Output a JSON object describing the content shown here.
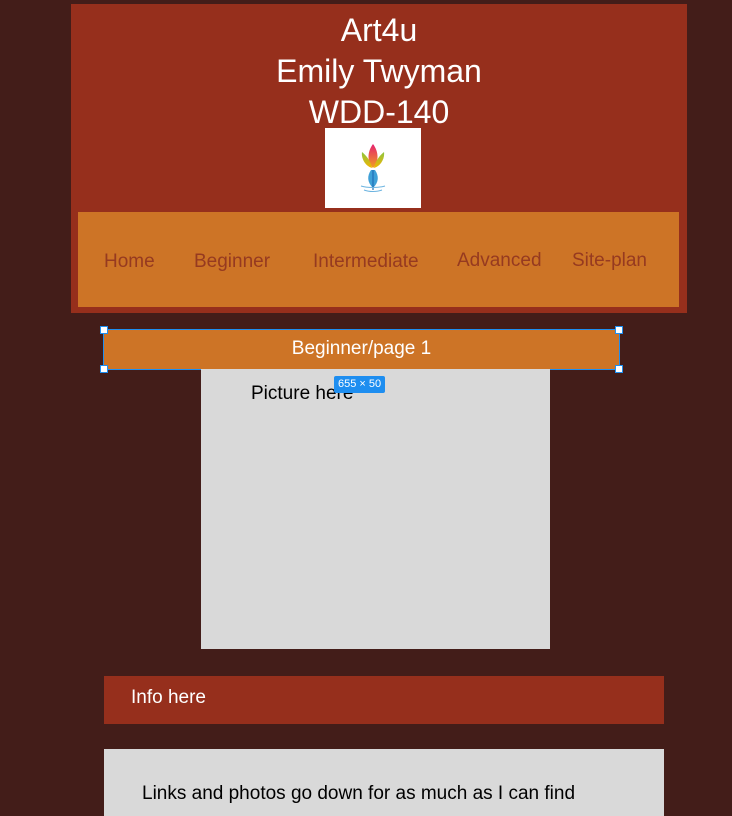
{
  "header": {
    "title_line_1": "Art4u",
    "title_line_2": "Emily Twyman",
    "title_line_3": "WDD-140",
    "logo_icon": "lotus-flower-logo"
  },
  "nav": {
    "items": [
      {
        "label": "Home"
      },
      {
        "label": "Beginner"
      },
      {
        "label": "Intermediate"
      },
      {
        "label": "Advanced"
      },
      {
        "label": "Site-plan"
      }
    ]
  },
  "banner": {
    "label": "Beginner/page 1"
  },
  "selection": {
    "dimensions_label": "655 × 50"
  },
  "picture": {
    "label": "Picture here"
  },
  "info": {
    "label": "Info here"
  },
  "links": {
    "text": "Links and photos go down for as much as I can find"
  },
  "colors": {
    "background": "#431d19",
    "header": "#962f1c",
    "nav": "#cd7426",
    "nav_text": "#963a20",
    "placeholder": "#d9d9d9",
    "selection": "#1e8ef0"
  }
}
